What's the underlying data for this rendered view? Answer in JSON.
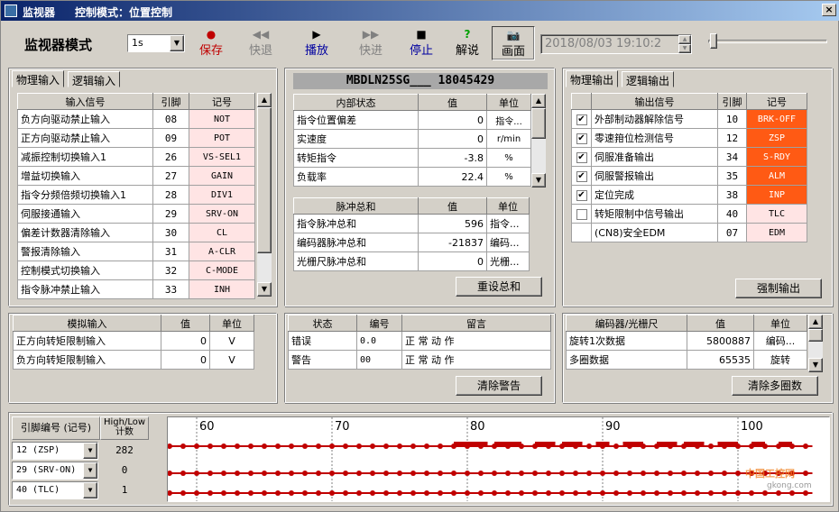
{
  "window": {
    "title": "监视器",
    "subtitle": "控制模式：位置控制",
    "close": "×"
  },
  "toolbar": {
    "monitor_mode_label": "监视器模式",
    "interval": "1s",
    "save": "保存",
    "rewind": "快退",
    "play": "播放",
    "forward": "快进",
    "stop": "停止",
    "explain": "解说",
    "screen": "画面",
    "datetime": "2018/08/03 19:10:2"
  },
  "physical_input": {
    "tabs": [
      "物理输入",
      "逻辑输入"
    ],
    "headers": [
      "输入信号",
      "引脚",
      "记号"
    ],
    "rows": [
      [
        "负方向驱动禁止输入",
        "08",
        "NOT"
      ],
      [
        "正方向驱动禁止输入",
        "09",
        "POT"
      ],
      [
        "减振控制切换输入1",
        "26",
        "VS-SEL1"
      ],
      [
        "增益切换输入",
        "27",
        "GAIN"
      ],
      [
        "指令分频倍频切换输入1",
        "28",
        "DIV1"
      ],
      [
        "伺服接通输入",
        "29",
        "SRV-ON"
      ],
      [
        "偏差计数器清除输入",
        "30",
        "CL"
      ],
      [
        "警报清除输入",
        "31",
        "A-CLR"
      ],
      [
        "控制模式切换输入",
        "32",
        "C-MODE"
      ],
      [
        "指令脉冲禁止输入",
        "33",
        "INH"
      ]
    ]
  },
  "internal": {
    "model": "MBDLN25SG___ 18045429",
    "headers": [
      "内部状态",
      "值",
      "单位"
    ],
    "rows": [
      [
        "指令位置偏差",
        "0",
        "指令..."
      ],
      [
        "实速度",
        "0",
        "r/min"
      ],
      [
        "转矩指令",
        "-3.8",
        "%"
      ],
      [
        "负载率",
        "22.4",
        "%"
      ]
    ],
    "pulse_headers": [
      "脉冲总和",
      "值",
      "单位"
    ],
    "pulse_rows": [
      [
        "指令脉冲总和",
        "596",
        "指令..."
      ],
      [
        "编码器脉冲总和",
        "-21837",
        "编码..."
      ],
      [
        "光栅尺脉冲总和",
        "0",
        "光栅..."
      ]
    ],
    "reset_button": "重设总和"
  },
  "physical_output": {
    "tabs": [
      "物理输出",
      "逻辑输出"
    ],
    "headers": [
      "输出信号",
      "引脚",
      "记号"
    ],
    "rows": [
      [
        true,
        "外部制动器解除信号",
        "10",
        "BRK-OFF",
        true
      ],
      [
        true,
        "零速箝位检测信号",
        "12",
        "ZSP",
        true
      ],
      [
        true,
        "伺服准备输出",
        "34",
        "S-RDY",
        true
      ],
      [
        true,
        "伺服警报输出",
        "35",
        "ALM",
        true
      ],
      [
        true,
        "定位完成",
        "38",
        "INP",
        true
      ],
      [
        false,
        "转矩限制中信号输出",
        "40",
        "TLC",
        false
      ],
      [
        null,
        "(CN8)安全EDM",
        "07",
        "EDM",
        false
      ]
    ],
    "force_button": "强制输出"
  },
  "analog": {
    "headers": [
      "模拟输入",
      "值",
      "单位"
    ],
    "rows": [
      [
        "正方向转矩限制输入",
        "0",
        "V"
      ],
      [
        "负方向转矩限制输入",
        "0",
        "V"
      ]
    ]
  },
  "status": {
    "headers": [
      "状态",
      "编号",
      "留言"
    ],
    "rows": [
      [
        "错误",
        "0.0",
        "正 常 动 作"
      ],
      [
        "警告",
        "00",
        "正 常 动 作"
      ]
    ],
    "clear_button": "清除警告"
  },
  "encoder": {
    "headers": [
      "编码器/光栅尺",
      "值",
      "单位"
    ],
    "rows": [
      [
        "旋转1次数据",
        "5800887",
        "编码..."
      ],
      [
        "多圈数据",
        "65535",
        "旋转"
      ]
    ],
    "clear_button": "清除多圈数"
  },
  "graph": {
    "col1": "引脚编号 (记号)",
    "col2": "High/Low\n计数",
    "signals": [
      {
        "label": "12 (ZSP)",
        "count": "282"
      },
      {
        "label": "29 (SRV-ON)",
        "count": "0"
      },
      {
        "label": "40 (TLC)",
        "count": "1"
      }
    ],
    "ticks": [
      "60",
      "70",
      "80",
      "90",
      "100"
    ],
    "watermark": "中国工控网",
    "watermark_url": "gkong.com"
  },
  "colors": {
    "pink": "#ffe4e4",
    "orange": "#ff5a14",
    "signal": "#c00000"
  }
}
